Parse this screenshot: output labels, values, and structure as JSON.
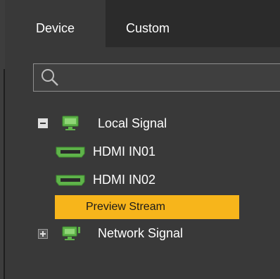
{
  "tabs": [
    {
      "label": "Device",
      "active": true
    },
    {
      "label": "Custom",
      "active": false
    }
  ],
  "search": {
    "value": ""
  },
  "tree": {
    "local_signal": {
      "label": "Local Signal",
      "expanded": true
    },
    "inputs": [
      {
        "label": "HDMI IN01"
      },
      {
        "label": "HDMI IN02"
      }
    ],
    "preview_stream": {
      "label": "Preview Stream",
      "selected": true
    },
    "network_signal": {
      "label": "Network Signal",
      "expanded": false
    }
  },
  "colors": {
    "panel_bg": "#393939",
    "tabbar_bg": "#2b2b2b",
    "selected_bg": "#f7b51b",
    "icon_green": "#5fb34a"
  },
  "icons": {
    "search": "search-icon",
    "local_signal": "monitor-icon",
    "hdmi": "hdmi-port-icon",
    "network_signal": "network-monitor-icon",
    "collapse": "minus-square-icon",
    "expand": "plus-square-icon"
  }
}
